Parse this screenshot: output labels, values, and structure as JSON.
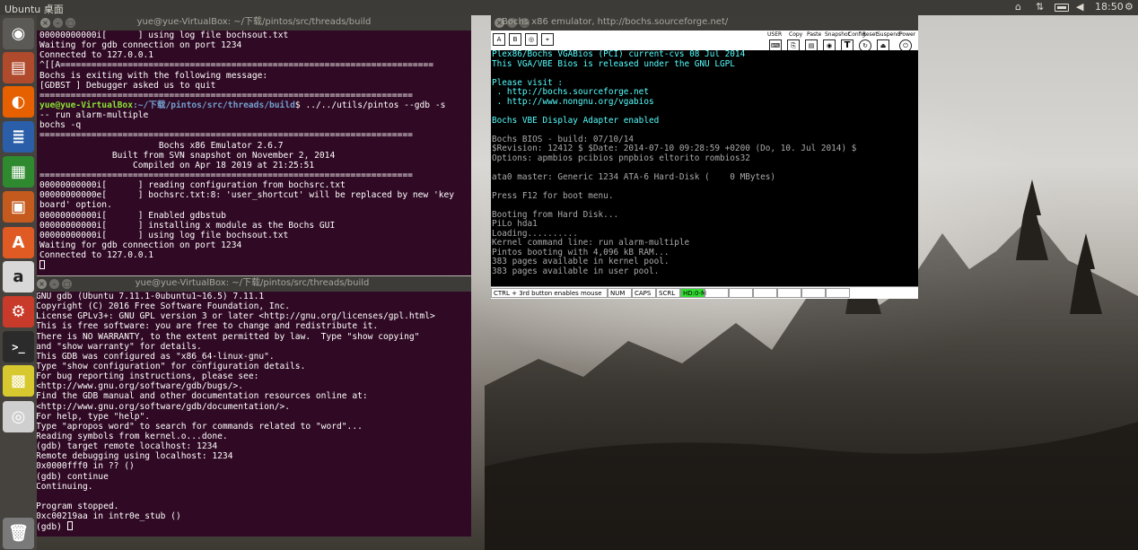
{
  "topbar": {
    "title": "Ubuntu 桌面",
    "clock": "18:50",
    "indicators": [
      "input-method-icon",
      "network-icon",
      "battery-icon",
      "volume-icon",
      "gear-icon"
    ]
  },
  "launcher": {
    "items": [
      {
        "name": "ubuntu-dash",
        "icon": "ubuntu-logo-icon",
        "color": "#5b5a56"
      },
      {
        "name": "files",
        "icon": "files-icon",
        "color": "#b04a2c"
      },
      {
        "name": "firefox",
        "icon": "firefox-icon",
        "color": "#e66000"
      },
      {
        "name": "writer",
        "icon": "document-icon",
        "color": "#2a5ea8"
      },
      {
        "name": "calc",
        "icon": "spreadsheet-icon",
        "color": "#2f8a2f"
      },
      {
        "name": "impress",
        "icon": "presentation-icon",
        "color": "#c45a1d"
      },
      {
        "name": "software-center",
        "icon": "software-center-icon",
        "color": "#e05a24"
      },
      {
        "name": "amazon",
        "icon": "amazon-icon",
        "color": "#d8d8d8"
      },
      {
        "name": "settings",
        "icon": "system-settings-icon",
        "color": "#c83a2a"
      },
      {
        "name": "terminal",
        "icon": "terminal-icon",
        "color": "#2b2b2b"
      },
      {
        "name": "virtualbox",
        "icon": "package-icon",
        "color": "#d8c830"
      },
      {
        "name": "dvd",
        "icon": "dvd-icon",
        "color": "#cfcfcf"
      },
      {
        "name": "trash",
        "icon": "trash-icon",
        "color": "#7a7a7a"
      }
    ]
  },
  "terminal1": {
    "title": "yue@yue-VirtualBox: ~/下载/pintos/src/threads/build",
    "lines": [
      "00000000000i[      ] using log file bochsout.txt",
      "Waiting for gdb connection on port 1234",
      "Connected to 127.0.0.1",
      "^[[A========================================================================",
      "Bochs is exiting with the following message:",
      "[GDBST ] Debugger asked us to quit",
      "========================================================================",
      {
        "prompt": "yue@yue-VirtualBox",
        "path": ":~/下载/pintos/src/threads/build",
        "cmd": "$ ../../utils/pintos --gdb -s"
      },
      "-- run alarm-multiple",
      "bochs -q",
      "========================================================================",
      "                       Bochs x86 Emulator 2.6.7",
      "              Built from SVN snapshot on November 2, 2014",
      "                  Compiled on Apr 18 2019 at 21:25:51",
      "========================================================================",
      "00000000000i[      ] reading configuration from bochsrc.txt",
      "00000000000e[      ] bochsrc.txt:8: 'user_shortcut' will be replaced by new 'key",
      "board' option.",
      "00000000000i[      ] Enabled gdbstub",
      "00000000000i[      ] installing x module as the Bochs GUI",
      "00000000000i[      ] using log file bochsout.txt",
      "Waiting for gdb connection on port 1234",
      "Connected to 127.0.0.1"
    ]
  },
  "terminal2": {
    "title": "yue@yue-VirtualBox: ~/下载/pintos/src/threads/build",
    "lines": [
      "GNU gdb (Ubuntu 7.11.1-0ubuntu1~16.5) 7.11.1",
      "Copyright (C) 2016 Free Software Foundation, Inc.",
      "License GPLv3+: GNU GPL version 3 or later <http://gnu.org/licenses/gpl.html>",
      "This is free software: you are free to change and redistribute it.",
      "There is NO WARRANTY, to the extent permitted by law.  Type \"show copying\"",
      "and \"show warranty\" for details.",
      "This GDB was configured as \"x86_64-linux-gnu\".",
      "Type \"show configuration\" for configuration details.",
      "For bug reporting instructions, please see:",
      "<http://www.gnu.org/software/gdb/bugs/>.",
      "Find the GDB manual and other documentation resources online at:",
      "<http://www.gnu.org/software/gdb/documentation/>.",
      "For help, type \"help\".",
      "Type \"apropos word\" to search for commands related to \"word\"...",
      "Reading symbols from kernel.o...done.",
      "(gdb) target remote localhost: 1234",
      "Remote debugging using localhost: 1234",
      "0x0000fff0 in ?? ()",
      "(gdb) continue",
      "Continuing.",
      "",
      "Program stopped.",
      "0xc00219aa in intr0e_stub ()",
      "(gdb) "
    ]
  },
  "bochs": {
    "title": "Bochs x86 emulator, http://bochs.sourceforge.net/",
    "toolbar_labels": [
      "USER",
      "Copy",
      "Paste",
      "Snapshot",
      "Config",
      "Reset",
      "Suspend",
      "Power"
    ],
    "screen": [
      {
        "t": "Plex86/Bochs VGABios (PCI) current-cvs 08 Jul 2014",
        "c": "cy"
      },
      {
        "t": "This VGA/VBE Bios is released under the GNU LGPL",
        "c": "cy"
      },
      {
        "t": "",
        "c": "wt"
      },
      {
        "t": "Please visit :",
        "c": "cy"
      },
      {
        "t": " . http://bochs.sourceforge.net",
        "c": "cy"
      },
      {
        "t": " . http://www.nongnu.org/vgabios",
        "c": "cy"
      },
      {
        "t": "",
        "c": "wt"
      },
      {
        "t": "Bochs VBE Display Adapter enabled",
        "c": "cy"
      },
      {
        "t": "",
        "c": "wt"
      },
      {
        "t": "Bochs BIOS - build: 07/10/14",
        "c": "wt"
      },
      {
        "t": "$Revision: 12412 $ $Date: 2014-07-10 09:28:59 +0200 (Do, 10. Jul 2014) $",
        "c": "wt"
      },
      {
        "t": "Options: apmbios pcibios pnpbios eltorito rombios32",
        "c": "wt"
      },
      {
        "t": "",
        "c": "wt"
      },
      {
        "t": "ata0 master: Generic 1234 ATA-6 Hard-Disk (    0 MBytes)",
        "c": "wt"
      },
      {
        "t": "",
        "c": "wt"
      },
      {
        "t": "Press F12 for boot menu.",
        "c": "wt"
      },
      {
        "t": "",
        "c": "wt"
      },
      {
        "t": "Booting from Hard Disk...",
        "c": "wt"
      },
      {
        "t": "PiLo hda1",
        "c": "wt"
      },
      {
        "t": "Loading..........",
        "c": "wt"
      },
      {
        "t": "Kernel command line: run alarm-multiple",
        "c": "wt"
      },
      {
        "t": "Pintos booting with 4,096 kB RAM...",
        "c": "wt"
      },
      {
        "t": "383 pages available in kernel pool.",
        "c": "wt"
      },
      {
        "t": "383 pages available in user pool.",
        "c": "wt"
      }
    ],
    "status": [
      {
        "t": "CTRL + 3rd button enables mouse",
        "on": false
      },
      {
        "t": "NUM",
        "on": false
      },
      {
        "t": "CAPS",
        "on": false
      },
      {
        "t": "SCRL",
        "on": false
      },
      {
        "t": "HD:0-M",
        "on": true
      },
      {
        "t": "",
        "on": false
      },
      {
        "t": "",
        "on": false
      },
      {
        "t": "",
        "on": false
      },
      {
        "t": "",
        "on": false
      },
      {
        "t": "",
        "on": false
      },
      {
        "t": "",
        "on": false
      }
    ]
  }
}
